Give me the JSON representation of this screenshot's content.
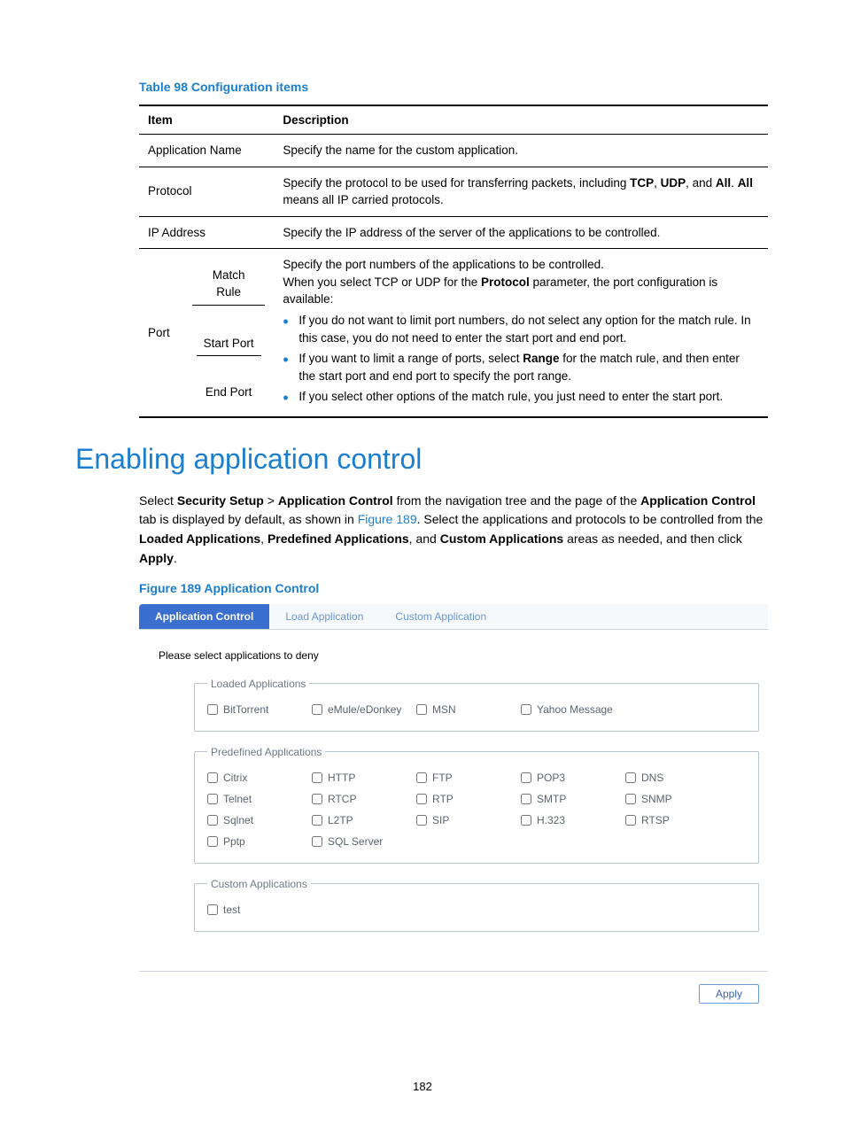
{
  "table": {
    "caption": "Table 98 Configuration items",
    "headers": {
      "item": "Item",
      "desc": "Description"
    },
    "rows": {
      "app_name": {
        "item": "Application Name",
        "desc": "Specify the name for the custom application."
      },
      "protocol": {
        "item": "Protocol",
        "desc": [
          "Specify the protocol to be used for transferring packets, including ",
          "TCP",
          ", ",
          "UDP",
          ", and ",
          "All",
          ". ",
          "All",
          " means all IP carried protocols."
        ]
      },
      "ip": {
        "item": "IP Address",
        "desc": "Specify the IP address of the server of the applications to be controlled."
      },
      "port": {
        "item": "Port",
        "sub": {
          "match": "Match Rule",
          "start": "Start Port",
          "end": "End Port"
        },
        "desc": {
          "line1": "Specify the port numbers of the applications to be controlled.",
          "line2a": "When you select TCP or UDP for the ",
          "line2b": "Protocol",
          "line2c": " parameter, the port configuration is available:",
          "b1": "If you do not want to limit port numbers, do not select any option for the match rule. In this case, you do not need to enter the start port and end port.",
          "b2a": "If you want to limit a range of ports, select ",
          "b2b": "Range",
          "b2c": " for the match rule, and then enter the start port and end port to specify the port range.",
          "b3": "If you select other options of the match rule, you just need to enter the start port."
        }
      }
    }
  },
  "section": {
    "heading": "Enabling application control",
    "para": {
      "t1": "Select ",
      "b1": "Security Setup",
      "t2": " > ",
      "b2": "Application Control",
      "t3": " from the navigation tree and the page of the ",
      "b3": "Application Control",
      "t4": " tab is displayed by default, as shown in ",
      "link": "Figure 189",
      "t5": ". Select the applications and protocols to be controlled from the ",
      "b4": "Loaded Applications",
      "t6": ", ",
      "b5": "Predefined Applications",
      "t7": ", and ",
      "b6": "Custom Applications",
      "t8": " areas as needed, and then click ",
      "b7": "Apply",
      "t9": "."
    }
  },
  "figure": {
    "caption": "Figure 189 Application Control"
  },
  "ui": {
    "tabs": {
      "t1": "Application Control",
      "t2": "Load Application",
      "t3": "Custom Application"
    },
    "prompt": "Please select applications to deny",
    "groups": {
      "loaded": {
        "legend": "Loaded Applications",
        "items": [
          "BitTorrent",
          "eMule/eDonkey",
          "MSN",
          "Yahoo Message"
        ]
      },
      "predef": {
        "legend": "Predefined Applications",
        "items": [
          "Citrix",
          "HTTP",
          "FTP",
          "POP3",
          "DNS",
          "Telnet",
          "RTCP",
          "RTP",
          "SMTP",
          "SNMP",
          "Sqlnet",
          "L2TP",
          "SIP",
          "H.323",
          "RTSP",
          "Pptp",
          "SQL Server"
        ]
      },
      "custom": {
        "legend": "Custom Applications",
        "items": [
          "test"
        ]
      }
    },
    "apply": "Apply"
  },
  "page_number": "182"
}
